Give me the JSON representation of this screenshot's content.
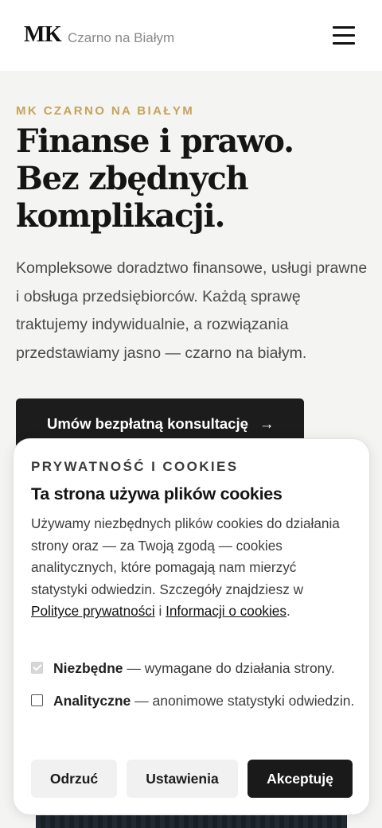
{
  "header": {
    "logo_mark": "MK",
    "logo_text": "Czarno na Białym",
    "menu_icon": "hamburger-menu-icon"
  },
  "hero": {
    "eyebrow": "MK CZARNO NA BIAŁYM",
    "title_lines": [
      "Finanse i prawo.",
      "Bez zbędnych",
      "komplikacji."
    ],
    "description": "Kompleksowe doradztwo finansowe, usługi prawne i obsługa przedsiębiorców. Każdą sprawę traktujemy indywidualnie, a rozwiązania przedstawiamy jasno — czarno na białym.",
    "cta_label": "Umów bezpłatną konsultację",
    "cta_icon": "arrow-right-icon"
  },
  "cookie": {
    "eyebrow": "PRYWATNOŚĆ I COOKIES",
    "title": "Ta strona używa plików cookies",
    "text_before": "Używamy niezbędnych plików cookies do działania strony oraz — za Twoją zgodą — cookies analitycznych, które pomagają nam mierzyć statystyki odwiedzin. Szczegóły znajdziesz w ",
    "privacy_link": "Polityce prywatności",
    "text_middle": " i ",
    "info_link": "Informacji o cookies",
    "text_after": ".",
    "options": [
      {
        "name": "Niezbędne",
        "desc": " — wymagane do działania strony.",
        "checked": true,
        "disabled": true
      },
      {
        "name": "Analityczne",
        "desc": " — anonimowe statystyki odwiedzin.",
        "checked": false,
        "disabled": false
      }
    ],
    "buttons": {
      "reject": "Odrzuć",
      "settings": "Ustawienia",
      "accept": "Akceptuję"
    }
  },
  "colors": {
    "accent": "#c4a35a",
    "dark": "#1c1c1c",
    "background": "#f4f4f2"
  }
}
